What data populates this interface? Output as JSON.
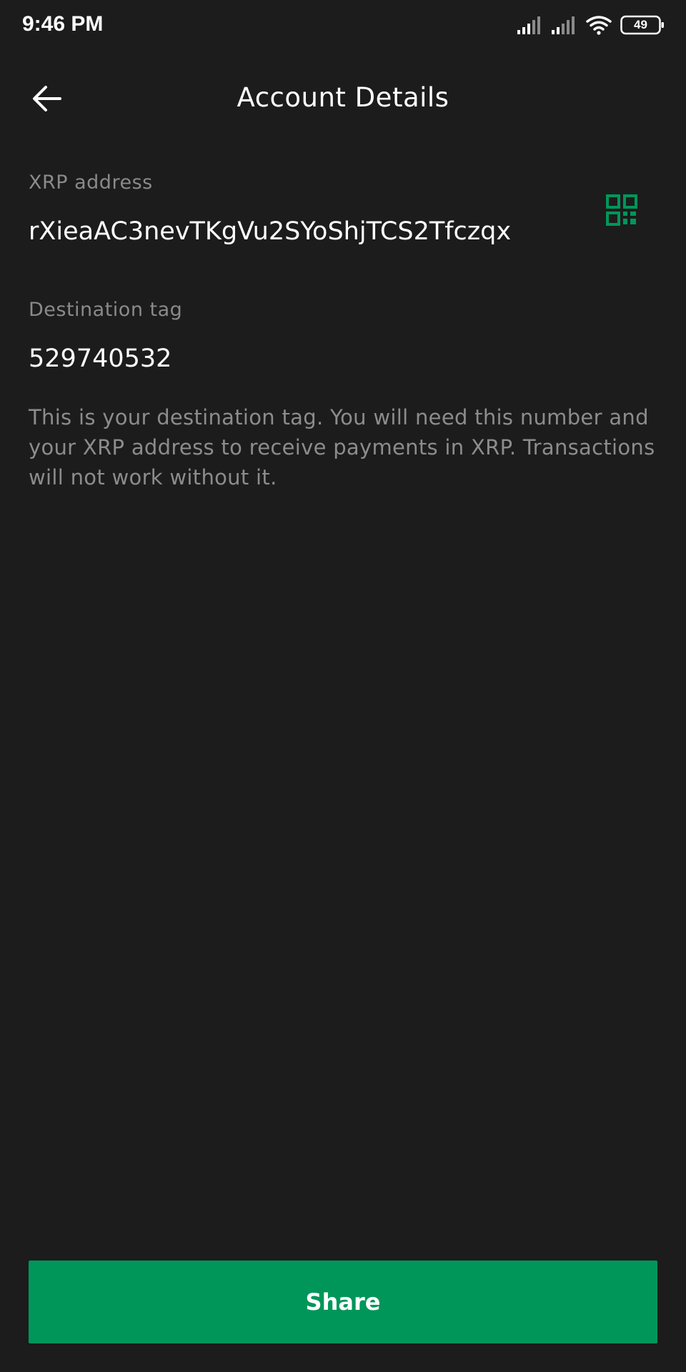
{
  "status_bar": {
    "time": "9:46 PM",
    "battery": "49",
    "icons": [
      "signal-icon",
      "signal-icon",
      "wifi-icon",
      "battery-icon"
    ]
  },
  "header": {
    "title": "Account Details",
    "back_icon": "back-arrow-icon"
  },
  "account": {
    "address_label": "XRP address",
    "address_value": "rXieaAC3nevTKgVu2SYoShjTCS2Tfczqx",
    "qr_icon": "qr-code-icon",
    "tag_label": "Destination tag",
    "tag_value": "529740532",
    "info_text": "This is your destination tag. You will need this number and your XRP address to receive payments in XRP. Transactions will not work without it."
  },
  "actions": {
    "share_label": "Share"
  },
  "colors": {
    "background": "#1c1c1c",
    "accent": "#00965a",
    "label": "#8a8a8a",
    "text": "#ffffff"
  }
}
